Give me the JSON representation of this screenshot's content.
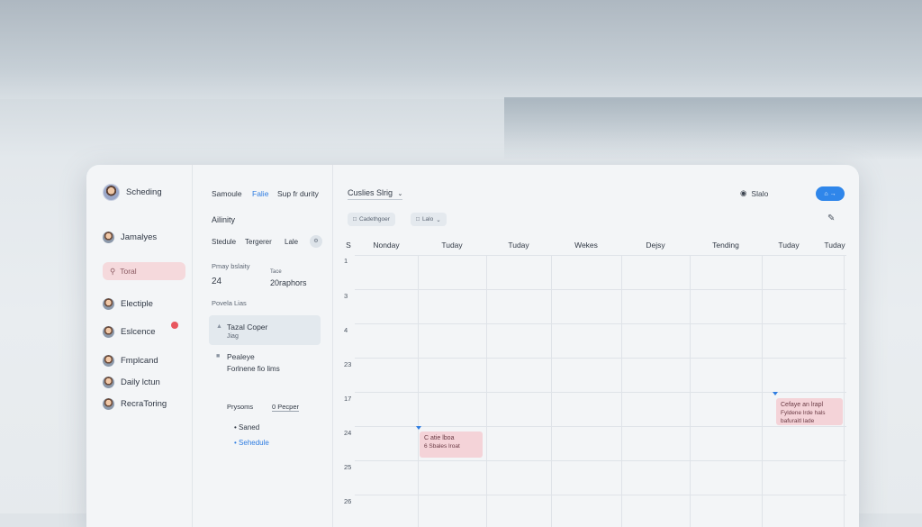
{
  "sidebar": {
    "brand": "Scheding",
    "items": [
      {
        "label": "Jamalyes"
      },
      {
        "label": "Electiple"
      },
      {
        "label": "Eslcence"
      },
      {
        "label": "Fmplcand"
      },
      {
        "label": "Daily lctun"
      },
      {
        "label": "RecraToring"
      }
    ],
    "search_label": "Toral"
  },
  "panel": {
    "tabs": [
      "Samoule",
      "Falie",
      "Sup fr durity"
    ],
    "section_title": "Ailinity",
    "sub_tabs": [
      "Stedule",
      "Tergerer",
      "Lale"
    ],
    "stats": {
      "label_1": "Pmay bslaity",
      "value_1": "24",
      "label_2": "Tace",
      "value_2": "20raphors"
    },
    "list_heading": "Povela Lias",
    "items": [
      {
        "title": "Tazal Coper",
        "subtitle": "Jiag"
      },
      {
        "title": "Pealeye",
        "subtitle": "Forlnene fio lims"
      }
    ],
    "links": {
      "label_1": "Prysoms",
      "label_2": "0 Pecper"
    },
    "bullets": [
      "Saned",
      "Sehedule"
    ]
  },
  "calendar": {
    "view_select": "Cuslies Slrig",
    "filters": [
      "Cadethgoer",
      "Lalo"
    ],
    "status_label": "Slalo",
    "new_button": "⌂ →",
    "days": [
      "S",
      "Nonday",
      "Tuday",
      "Tuday",
      "Wekes",
      "Dejsy",
      "Tending",
      "Tuday",
      "Tuday"
    ],
    "row_labels": [
      "1",
      "3",
      "4",
      "23",
      "17",
      "24",
      "25",
      "26"
    ],
    "events": [
      {
        "line1": "Cefaye an lrapl",
        "line2": "Fyldene lrde hals",
        "line3": "bafuraitl lade"
      },
      {
        "line1": "C atie lboa",
        "line2": "6 Sbales lroat"
      }
    ]
  },
  "icons": [
    "avatar-icon",
    "search-icon",
    "settings-icon",
    "pencil-icon",
    "chevron-down-icon",
    "lock-icon"
  ],
  "colors": {
    "accent": "#2f86ea",
    "event": "#f4d3d8",
    "badge": "#e8565e"
  }
}
